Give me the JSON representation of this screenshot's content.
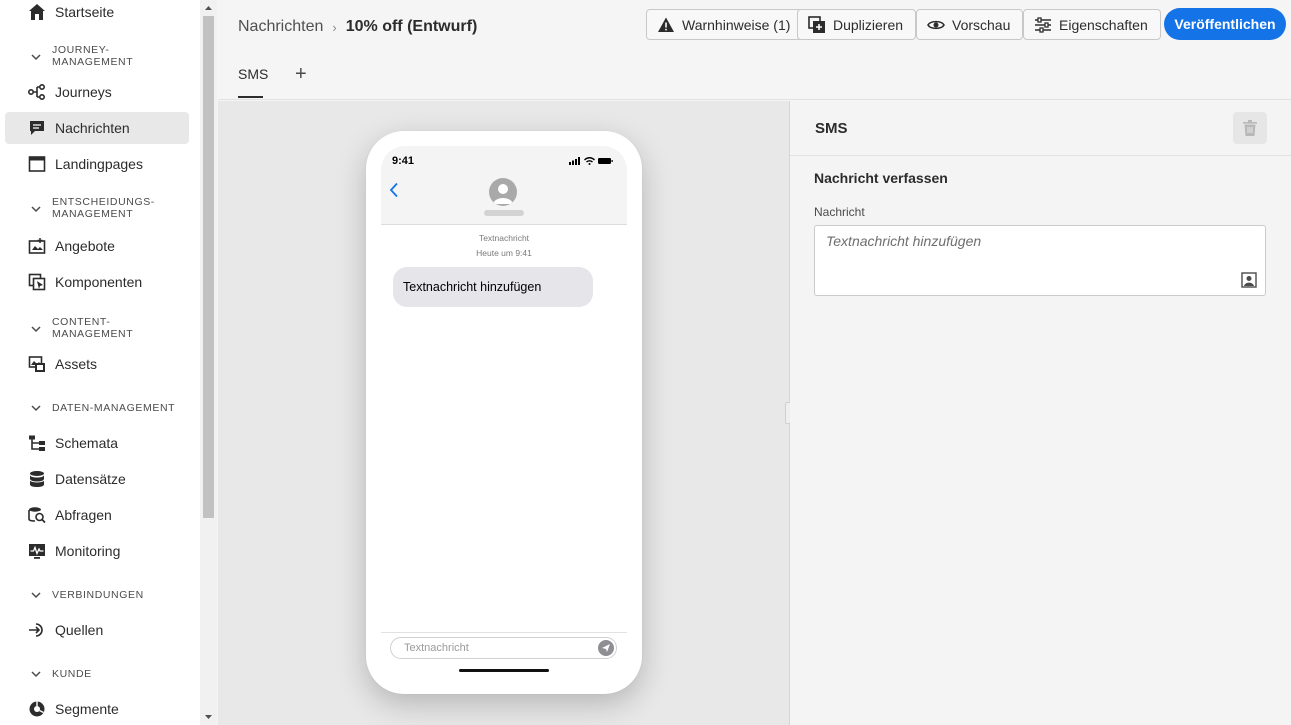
{
  "sidebar": {
    "items": [
      {
        "id": "startseite",
        "label": "Startseite"
      },
      {
        "id": "journeys",
        "label": "Journeys"
      },
      {
        "id": "nachrichten",
        "label": "Nachrichten",
        "active": true
      },
      {
        "id": "landingpages",
        "label": "Landingpages"
      },
      {
        "id": "angebote",
        "label": "Angebote"
      },
      {
        "id": "komponenten",
        "label": "Komponenten"
      },
      {
        "id": "assets",
        "label": "Assets"
      },
      {
        "id": "schemata",
        "label": "Schemata"
      },
      {
        "id": "datensaetze",
        "label": "Datensätze"
      },
      {
        "id": "abfragen",
        "label": "Abfragen"
      },
      {
        "id": "monitoring",
        "label": "Monitoring"
      },
      {
        "id": "quellen",
        "label": "Quellen"
      },
      {
        "id": "segmente",
        "label": "Segmente"
      }
    ],
    "sections": {
      "journey_line1": "JOURNEY-",
      "journey_line2": "MANAGEMENT",
      "entscheidung_line1": "ENTSCHEIDUNGS-",
      "entscheidung_line2": "MANAGEMENT",
      "content_line1": "CONTENT-",
      "content_line2": "MANAGEMENT",
      "daten": "DATEN-MANAGEMENT",
      "verbindungen": "VERBINDUNGEN",
      "kunde": "KUNDE"
    }
  },
  "header": {
    "breadcrumb_root": "Nachrichten",
    "breadcrumb_sep": "›",
    "breadcrumb_current": "10% off (Entwurf)",
    "buttons": {
      "warnings": "Warnhinweise (1)",
      "duplicate": "Duplizieren",
      "preview": "Vorschau",
      "properties": "Eigenschaften",
      "publish": "Veröffentlichen"
    },
    "tab_sms": "SMS",
    "tab_add": "+"
  },
  "phone": {
    "time": "9:41",
    "meta_line1": "Textnachricht",
    "meta_line2": "Heute um 9:41",
    "bubble_text": "Textnachricht hinzufügen",
    "input_placeholder": "Textnachricht"
  },
  "panel": {
    "title": "SMS",
    "section_title": "Nachricht verfassen",
    "field_label": "Nachricht",
    "textarea_placeholder": "Textnachricht hinzufügen"
  },
  "colors": {
    "accent": "#1473e6",
    "active_nav": "#e8e8e8",
    "bubble": "#e5e5ea"
  }
}
